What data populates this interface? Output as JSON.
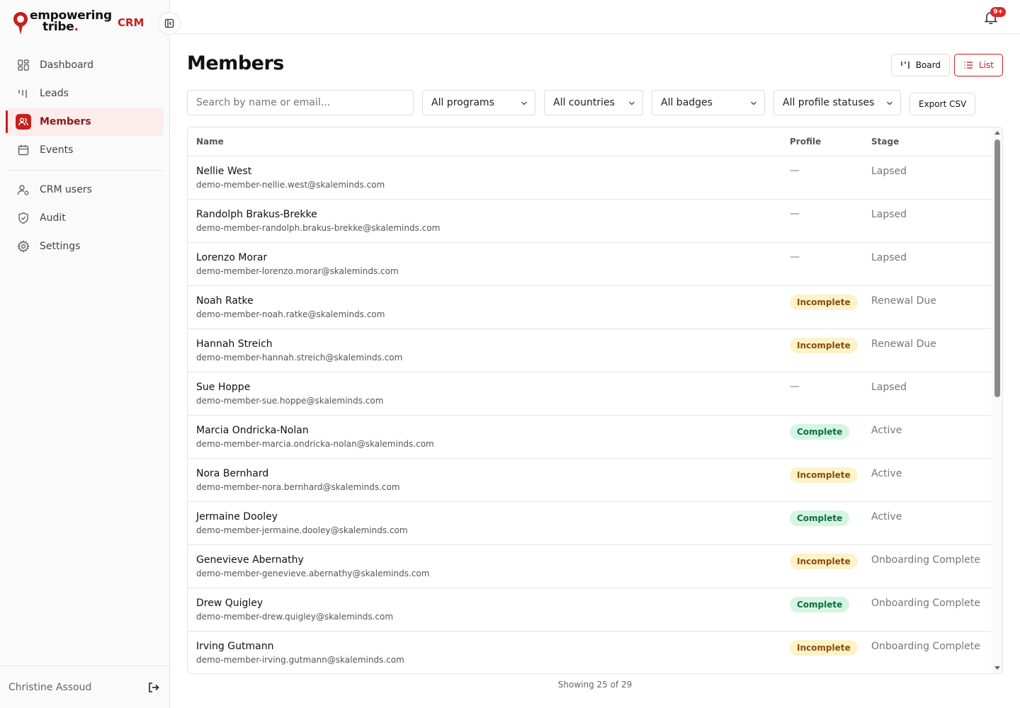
{
  "brand": {
    "line1": "empowering",
    "line2": "tribe",
    "dot": ".",
    "app": "CRM",
    "accent": "#c81e1e"
  },
  "sidebar": {
    "items": [
      {
        "label": "Dashboard",
        "icon": "dashboard-icon"
      },
      {
        "label": "Leads",
        "icon": "leads-icon"
      },
      {
        "label": "Members",
        "icon": "members-icon",
        "active": true
      },
      {
        "label": "Events",
        "icon": "calendar-icon"
      }
    ],
    "admin_items": [
      {
        "label": "CRM users",
        "icon": "user-gear-icon"
      },
      {
        "label": "Audit",
        "icon": "shield-icon"
      },
      {
        "label": "Settings",
        "icon": "gear-icon"
      }
    ],
    "user_name": "Christine Assoud"
  },
  "topbar": {
    "notifications": "9+"
  },
  "page": {
    "title": "Members"
  },
  "view_toggle": {
    "board": "Board",
    "list": "List",
    "active": "list"
  },
  "filters": {
    "search_placeholder": "Search by name or email...",
    "programs": "All programs",
    "countries": "All countries",
    "badges": "All badges",
    "profile_statuses": "All profile statuses",
    "export": "Export CSV"
  },
  "table": {
    "columns": [
      "Name",
      "Profile",
      "Stage"
    ],
    "rows": [
      {
        "name": "Nellie West",
        "email": "demo-member-nellie.west@skaleminds.com",
        "profile": "—",
        "stage": "Lapsed"
      },
      {
        "name": "Randolph Brakus-Brekke",
        "email": "demo-member-randolph.brakus-brekke@skaleminds.com",
        "profile": "—",
        "stage": "Lapsed"
      },
      {
        "name": "Lorenzo Morar",
        "email": "demo-member-lorenzo.morar@skaleminds.com",
        "profile": "—",
        "stage": "Lapsed"
      },
      {
        "name": "Noah Ratke",
        "email": "demo-member-noah.ratke@skaleminds.com",
        "profile": "Incomplete",
        "stage": "Renewal Due"
      },
      {
        "name": "Hannah Streich",
        "email": "demo-member-hannah.streich@skaleminds.com",
        "profile": "Incomplete",
        "stage": "Renewal Due"
      },
      {
        "name": "Sue Hoppe",
        "email": "demo-member-sue.hoppe@skaleminds.com",
        "profile": "—",
        "stage": "Lapsed"
      },
      {
        "name": "Marcia Ondricka-Nolan",
        "email": "demo-member-marcia.ondricka-nolan@skaleminds.com",
        "profile": "Complete",
        "stage": "Active"
      },
      {
        "name": "Nora Bernhard",
        "email": "demo-member-nora.bernhard@skaleminds.com",
        "profile": "Incomplete",
        "stage": "Active"
      },
      {
        "name": "Jermaine Dooley",
        "email": "demo-member-jermaine.dooley@skaleminds.com",
        "profile": "Complete",
        "stage": "Active"
      },
      {
        "name": "Genevieve Abernathy",
        "email": "demo-member-genevieve.abernathy@skaleminds.com",
        "profile": "Incomplete",
        "stage": "Onboarding Complete"
      },
      {
        "name": "Drew Quigley",
        "email": "demo-member-drew.quigley@skaleminds.com",
        "profile": "Complete",
        "stage": "Onboarding Complete"
      },
      {
        "name": "Irving Gutmann",
        "email": "demo-member-irving.gutmann@skaleminds.com",
        "profile": "Incomplete",
        "stage": "Onboarding Complete"
      }
    ]
  },
  "footer": {
    "showing": "Showing 25 of 29"
  }
}
